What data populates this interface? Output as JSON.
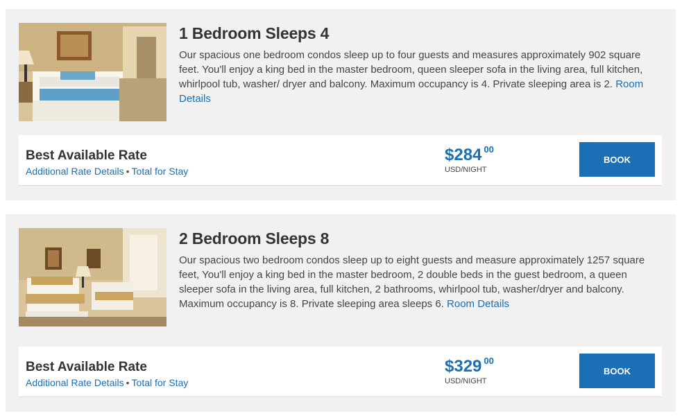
{
  "rooms": [
    {
      "title": "1 Bedroom Sleeps 4",
      "description": "Our spacious one bedroom condos sleep up to four guests and measures approximately 902 square feet. You'll enjoy a king bed in the master bedroom, queen sleeper sofa in the living area, full kitchen, whirlpool tub, washer/ dryer and balcony. Maximum occupancy is 4. Private sleeping area is 2.",
      "room_details_link": "Room Details",
      "rate": {
        "name": "Best Available Rate",
        "additional_link": "Additional Rate Details",
        "separator": "•",
        "total_link": "Total for Stay",
        "price_dollars": "$284",
        "price_cents": "00",
        "unit": "USD/NIGHT",
        "book_label": "BOOK"
      },
      "photo_icon": "bedroom-king-photo"
    },
    {
      "title": "2 Bedroom Sleeps 8",
      "description": "Our spacious two bedroom condos sleep up to eight guests and measure approximately 1257 square feet, You'll enjoy a king bed in the master bedroom, 2 double beds in the guest bedroom, a queen sleeper sofa in the living area, full kitchen, 2 bathrooms, whirlpool tub, washer/dryer and balcony. Maximum occupancy is 8. Private sleeping area sleeps 6.",
      "room_details_link": "Room Details",
      "rate": {
        "name": "Best Available Rate",
        "additional_link": "Additional Rate Details",
        "separator": "•",
        "total_link": "Total for Stay",
        "price_dollars": "$329",
        "price_cents": "00",
        "unit": "USD/NIGHT",
        "book_label": "BOOK"
      },
      "photo_icon": "bedroom-double-beds-photo"
    }
  ],
  "colors": {
    "accent": "#1a6fb5",
    "card_bg": "#f1f1f1",
    "text": "#333333"
  }
}
